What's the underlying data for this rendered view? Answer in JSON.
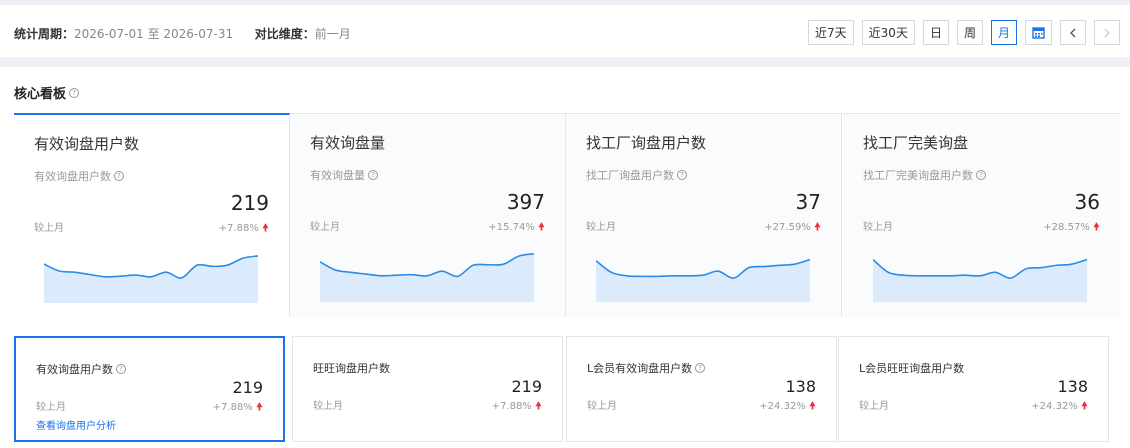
{
  "filter": {
    "period_label": "统计周期：",
    "period_value": "2026-07-01 至 2026-07-31",
    "compare_label": "对比维度：",
    "compare_value": "前一月",
    "buttons": [
      "近7天",
      "近30天",
      "日",
      "周",
      "月"
    ],
    "active_button": "月",
    "calendar_icon": "calendar-icon",
    "prev_icon": "chevron-left-icon",
    "next_icon": "chevron-right-icon"
  },
  "section": {
    "title": "核心看板",
    "help_icon": "question-circle-icon"
  },
  "colors": {
    "accent": "#1a73e8",
    "up": "#e8323c",
    "line": "#2b8be6",
    "area": "#dbebfb"
  },
  "kpis": [
    {
      "name": "有效询盘用户数",
      "sub": "有效询盘用户数",
      "value": "219",
      "compare": "较上月",
      "change": "+7.88%",
      "trend": [
        62,
        50,
        48,
        44,
        40,
        41,
        43,
        40,
        48,
        38,
        60,
        58,
        60,
        72,
        76
      ]
    },
    {
      "name": "有效询盘量",
      "sub": "有效询盘量",
      "value": "397",
      "compare": "较上月",
      "change": "+15.74%",
      "trend": [
        64,
        50,
        46,
        43,
        40,
        41,
        42,
        40,
        48,
        39,
        58,
        59,
        60,
        74,
        78
      ]
    },
    {
      "name": "找工厂询盘用户数",
      "sub": "找工厂询盘用户数",
      "value": "37",
      "compare": "较上月",
      "change": "+27.59%",
      "trend": [
        66,
        46,
        40,
        39,
        39,
        40,
        40,
        41,
        48,
        36,
        54,
        56,
        58,
        60,
        68
      ]
    },
    {
      "name": "找工厂完美询盘",
      "sub": "找工厂完美询盘用户数",
      "value": "36",
      "compare": "较上月",
      "change": "+28.57%",
      "trend": [
        68,
        46,
        41,
        40,
        40,
        40,
        41,
        40,
        46,
        36,
        52,
        54,
        58,
        60,
        68
      ]
    }
  ],
  "cards": [
    {
      "name": "有效询盘用户数",
      "help": true,
      "value": "219",
      "compare": "较上月",
      "change": "+7.88%",
      "link": "查看询盘用户分析"
    },
    {
      "name": "旺旺询盘用户数",
      "help": false,
      "value": "219",
      "compare": "较上月",
      "change": "+7.88%",
      "link": ""
    },
    {
      "name": "L会员有效询盘用户数",
      "help": true,
      "value": "138",
      "compare": "较上月",
      "change": "+24.32%",
      "link": ""
    },
    {
      "name": "L会员旺旺询盘用户数",
      "help": false,
      "value": "138",
      "compare": "较上月",
      "change": "+24.32%",
      "link": ""
    }
  ]
}
